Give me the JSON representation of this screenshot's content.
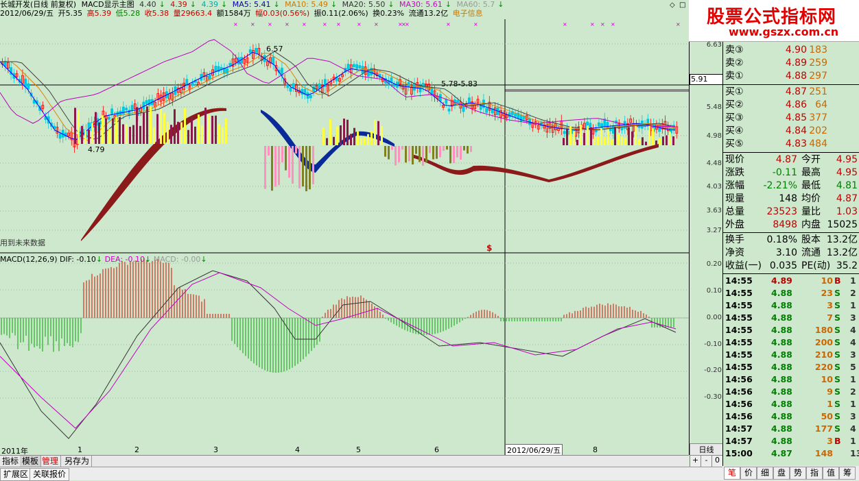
{
  "title_row": {
    "name": "长城开发(日线 前复权)",
    "indicator": "MACD显示主图",
    "v1": "4.40",
    "v2": "4.39",
    "v3": "4.39",
    "ma5": "MA5: 5.41",
    "ma10": "MA10: 5.49",
    "ma20": "MA20: 5.50",
    "ma30": "MA30: 5.61",
    "ma60": "MA60: 5.7"
  },
  "quote_row": {
    "date": "2012/06/29/五",
    "open": "开5.35",
    "high": "高5.39",
    "low": "低5.28",
    "close": "收5.38",
    "vol": "量29663.4",
    "amount": "额1584万",
    "change": "幅0.03(0.56%)",
    "amp": "振0.11(2.06%)",
    "turn": "换0.23%",
    "float": "流通13.2亿",
    "sector": "电子信息"
  },
  "price_axis": [
    "6.63",
    "5.91",
    "5.48",
    "4.98",
    "4.48",
    "4.03",
    "3.63",
    "3.27"
  ],
  "annotations": {
    "high_mark": "6.57",
    "low_mark": "4.79",
    "mid_mark": "5.78-5.83",
    "future_note": "用到未来数据",
    "signal": "$"
  },
  "macd_row": {
    "label": "MACD(12,26,9)",
    "dif": "DIF: -0.10",
    "dea": "DEA: -0.10",
    "macd": "MACD: -0.00"
  },
  "macd_axis": [
    "0.20",
    "0.10",
    "0.00",
    "-0.10",
    "-0.20",
    "-0.30"
  ],
  "months": [
    "2011年",
    "1",
    "2",
    "3",
    "4",
    "5",
    "6",
    "2012/06/29/五",
    "8"
  ],
  "period_label": "日线",
  "bottom_tabs": [
    "指标",
    "模板",
    "管理",
    "另存为"
  ],
  "ext_tabs": [
    "扩展区",
    "关联报价"
  ],
  "right_tabs": [
    "笔",
    "价",
    "细",
    "盘",
    "势",
    "指",
    "值",
    "筹"
  ],
  "logo": {
    "line1": "股票公式指标网",
    "line2": "www.gszx.com.cn"
  },
  "order_book": {
    "sell": [
      {
        "label": "卖③",
        "price": "4.90",
        "vol": "183"
      },
      {
        "label": "卖②",
        "price": "4.89",
        "vol": "259"
      },
      {
        "label": "卖①",
        "price": "4.88",
        "vol": "297"
      }
    ],
    "buy": [
      {
        "label": "买①",
        "price": "4.87",
        "vol": "251"
      },
      {
        "label": "买②",
        "price": "4.86",
        "vol": "64"
      },
      {
        "label": "买③",
        "price": "4.85",
        "vol": "377"
      },
      {
        "label": "买④",
        "price": "4.84",
        "vol": "202"
      },
      {
        "label": "买⑤",
        "price": "4.83",
        "vol": "484"
      }
    ]
  },
  "stats": [
    {
      "l1": "现价",
      "v1": "4.87",
      "l2": "今开",
      "v2": "4.95"
    },
    {
      "l1": "涨跌",
      "v1": "-0.11",
      "l2": "最高",
      "v2": "4.95"
    },
    {
      "l1": "涨幅",
      "v1": "-2.21%",
      "l2": "最低",
      "v2": "4.81"
    },
    {
      "l1": "现量",
      "v1": "148",
      "l2": "均价",
      "v2": "4.87"
    },
    {
      "l1": "总量",
      "v1": "23523",
      "l2": "量比",
      "v2": "1.03"
    },
    {
      "l1": "外盘",
      "v1": "8498",
      "l2": "内盘",
      "v2": "15025"
    }
  ],
  "fund": [
    {
      "l1": "换手",
      "v1": "0.18%",
      "l2": "股本",
      "v2": "13.2亿"
    },
    {
      "l1": "净资",
      "v1": "3.10",
      "l2": "流通",
      "v2": "13.2亿"
    },
    {
      "l1": "收益(一)",
      "v1": "0.035",
      "l2": "PE(动)",
      "v2": "35.2"
    }
  ],
  "ticks": [
    {
      "t": "14:55",
      "p": "4.89",
      "v": "10",
      "s": "B",
      "n": "1"
    },
    {
      "t": "14:55",
      "p": "4.88",
      "v": "23",
      "s": "S",
      "n": "2"
    },
    {
      "t": "14:55",
      "p": "4.88",
      "v": "3",
      "s": "S",
      "n": "1"
    },
    {
      "t": "14:55",
      "p": "4.88",
      "v": "7",
      "s": "S",
      "n": "3"
    },
    {
      "t": "14:55",
      "p": "4.88",
      "v": "180",
      "s": "S",
      "n": "4"
    },
    {
      "t": "14:55",
      "p": "4.88",
      "v": "200",
      "s": "S",
      "n": "4"
    },
    {
      "t": "14:55",
      "p": "4.88",
      "v": "210",
      "s": "S",
      "n": "3"
    },
    {
      "t": "14:55",
      "p": "4.88",
      "v": "220",
      "s": "S",
      "n": "5"
    },
    {
      "t": "14:56",
      "p": "4.88",
      "v": "10",
      "s": "S",
      "n": "1"
    },
    {
      "t": "14:56",
      "p": "4.88",
      "v": "9",
      "s": "S",
      "n": "2"
    },
    {
      "t": "14:56",
      "p": "4.88",
      "v": "1",
      "s": "S",
      "n": "1"
    },
    {
      "t": "14:56",
      "p": "4.88",
      "v": "50",
      "s": "S",
      "n": "3"
    },
    {
      "t": "14:57",
      "p": "4.88",
      "v": "177",
      "s": "S",
      "n": "4"
    },
    {
      "t": "14:57",
      "p": "4.88",
      "v": "3",
      "s": "B",
      "n": "1"
    },
    {
      "t": "15:00",
      "p": "4.87",
      "v": "148",
      "s": "",
      "n": "13"
    }
  ],
  "colors": {
    "bg": "#cde8cd",
    "up": "#c00000",
    "down": "#008000",
    "logo": "#e00000"
  }
}
